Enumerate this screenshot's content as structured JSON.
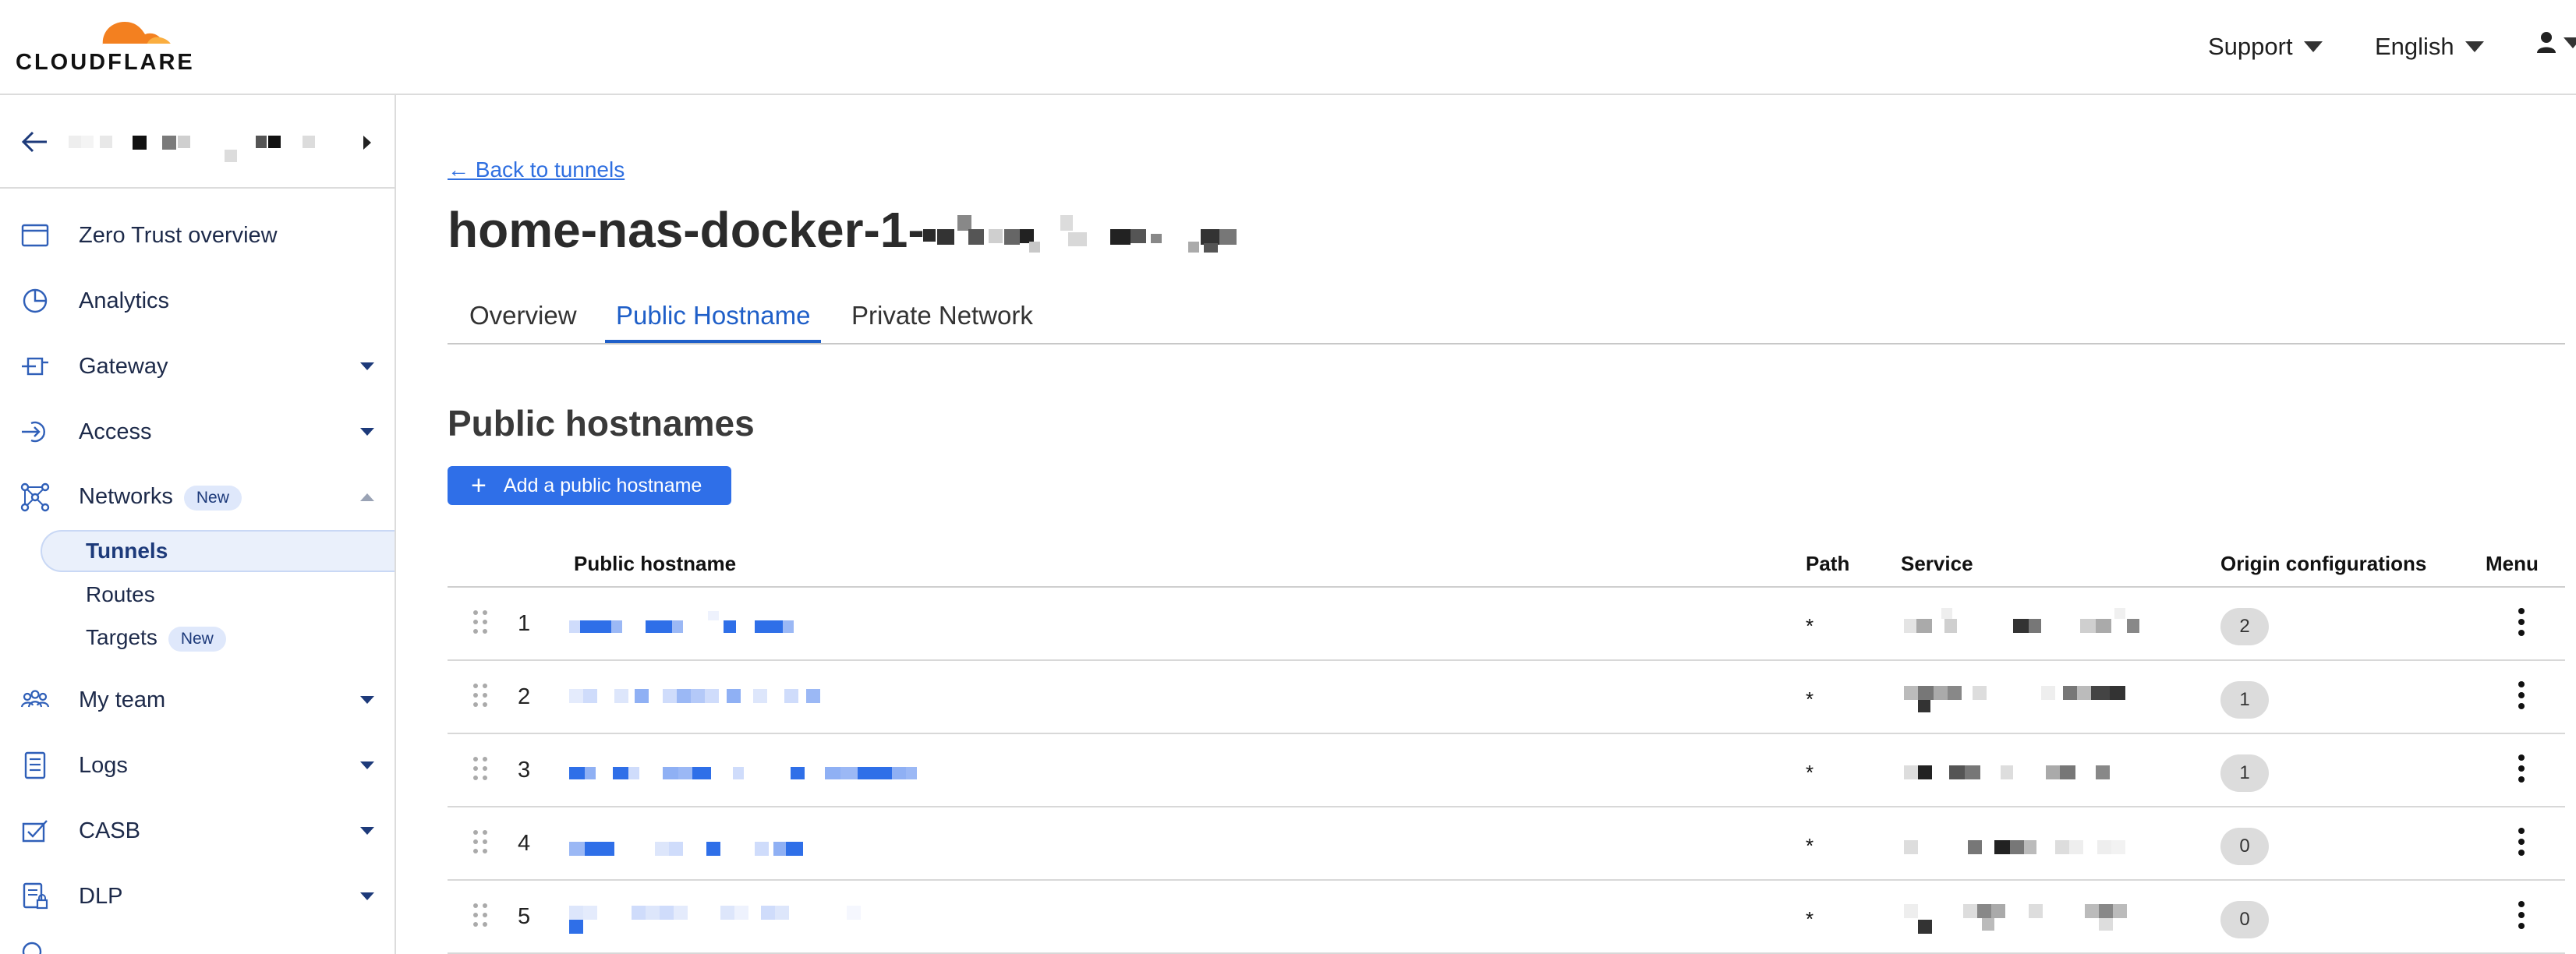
{
  "header": {
    "brand": "CLOUDFLARE",
    "support_label": "Support",
    "language_label": "English"
  },
  "sidebar": {
    "items": [
      {
        "label": "Zero Trust overview",
        "icon": "browser-window-icon",
        "expandable": false
      },
      {
        "label": "Analytics",
        "icon": "pie-chart-icon",
        "expandable": false
      },
      {
        "label": "Gateway",
        "icon": "gateway-icon",
        "expandable": true
      },
      {
        "label": "Access",
        "icon": "access-icon",
        "expandable": true
      },
      {
        "label": "Networks",
        "icon": "network-icon",
        "expandable": true,
        "expanded": true,
        "badge": "New"
      },
      {
        "label": "My team",
        "icon": "team-icon",
        "expandable": true
      },
      {
        "label": "Logs",
        "icon": "logs-icon",
        "expandable": true
      },
      {
        "label": "CASB",
        "icon": "casb-icon",
        "expandable": true
      },
      {
        "label": "DLP",
        "icon": "dlp-icon",
        "expandable": true
      }
    ],
    "subitems": [
      {
        "label": "Tunnels",
        "active": true
      },
      {
        "label": "Routes",
        "active": false
      },
      {
        "label": "Targets",
        "active": false,
        "badge": "New"
      }
    ]
  },
  "main": {
    "back_link": "← Back to tunnels",
    "title": "home-nas-docker-1-",
    "tabs": [
      {
        "label": "Overview",
        "active": false
      },
      {
        "label": "Public Hostname",
        "active": true
      },
      {
        "label": "Private Network",
        "active": false
      }
    ],
    "section_title": "Public hostnames",
    "add_button": "Add a public hostname",
    "table": {
      "columns": [
        "Public hostname",
        "Path",
        "Service",
        "Origin configurations",
        "Menu"
      ],
      "rows": [
        {
          "index": "1",
          "path": "*",
          "origin_configs": "2"
        },
        {
          "index": "2",
          "path": "*",
          "origin_configs": "1"
        },
        {
          "index": "3",
          "path": "*",
          "origin_configs": "1"
        },
        {
          "index": "4",
          "path": "*",
          "origin_configs": "0"
        },
        {
          "index": "5",
          "path": "*",
          "origin_configs": "0"
        }
      ]
    }
  },
  "colors": {
    "accent": "#2f6fe8",
    "nav_text": "#1d2a4a",
    "tab_active": "#1f5fc8",
    "badge_bg": "#dfe8fb",
    "logo_orange": "#f38020"
  }
}
